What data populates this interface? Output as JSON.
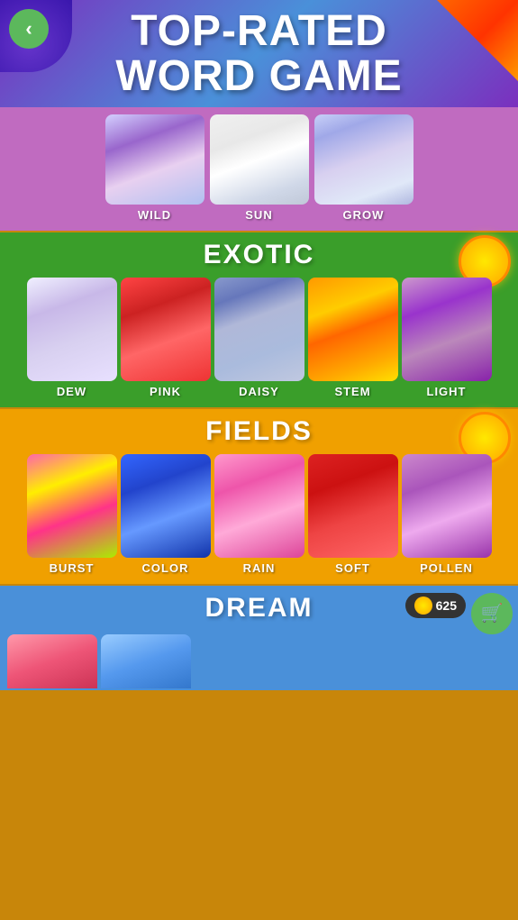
{
  "banner": {
    "title_line1": "TOP-RATED",
    "title_line2": "WORD GAME",
    "back_icon": "‹"
  },
  "wild_section": {
    "items": [
      {
        "label": "WILD",
        "img_class": "img-wild"
      },
      {
        "label": "SUN",
        "img_class": "img-sun"
      },
      {
        "label": "GROW",
        "img_class": "img-grow"
      }
    ]
  },
  "exotic_section": {
    "title": "EXOTIC",
    "items": [
      {
        "label": "DEW",
        "img_class": "img-dew"
      },
      {
        "label": "PINK",
        "img_class": "img-pink"
      },
      {
        "label": "DAISY",
        "img_class": "img-daisy"
      },
      {
        "label": "STEM",
        "img_class": "img-stem"
      },
      {
        "label": "LIGHT",
        "img_class": "img-light"
      }
    ]
  },
  "fields_section": {
    "title": "FIELDS",
    "items": [
      {
        "label": "BURST",
        "img_class": "img-burst"
      },
      {
        "label": "COLOR",
        "img_class": "img-color"
      },
      {
        "label": "RAIN",
        "img_class": "img-rain"
      },
      {
        "label": "SOFT",
        "img_class": "img-soft"
      },
      {
        "label": "POLLEN",
        "img_class": "img-pollen"
      }
    ]
  },
  "dream_section": {
    "title": "DREAM",
    "coins": "625",
    "coin_symbol": "🛒"
  }
}
